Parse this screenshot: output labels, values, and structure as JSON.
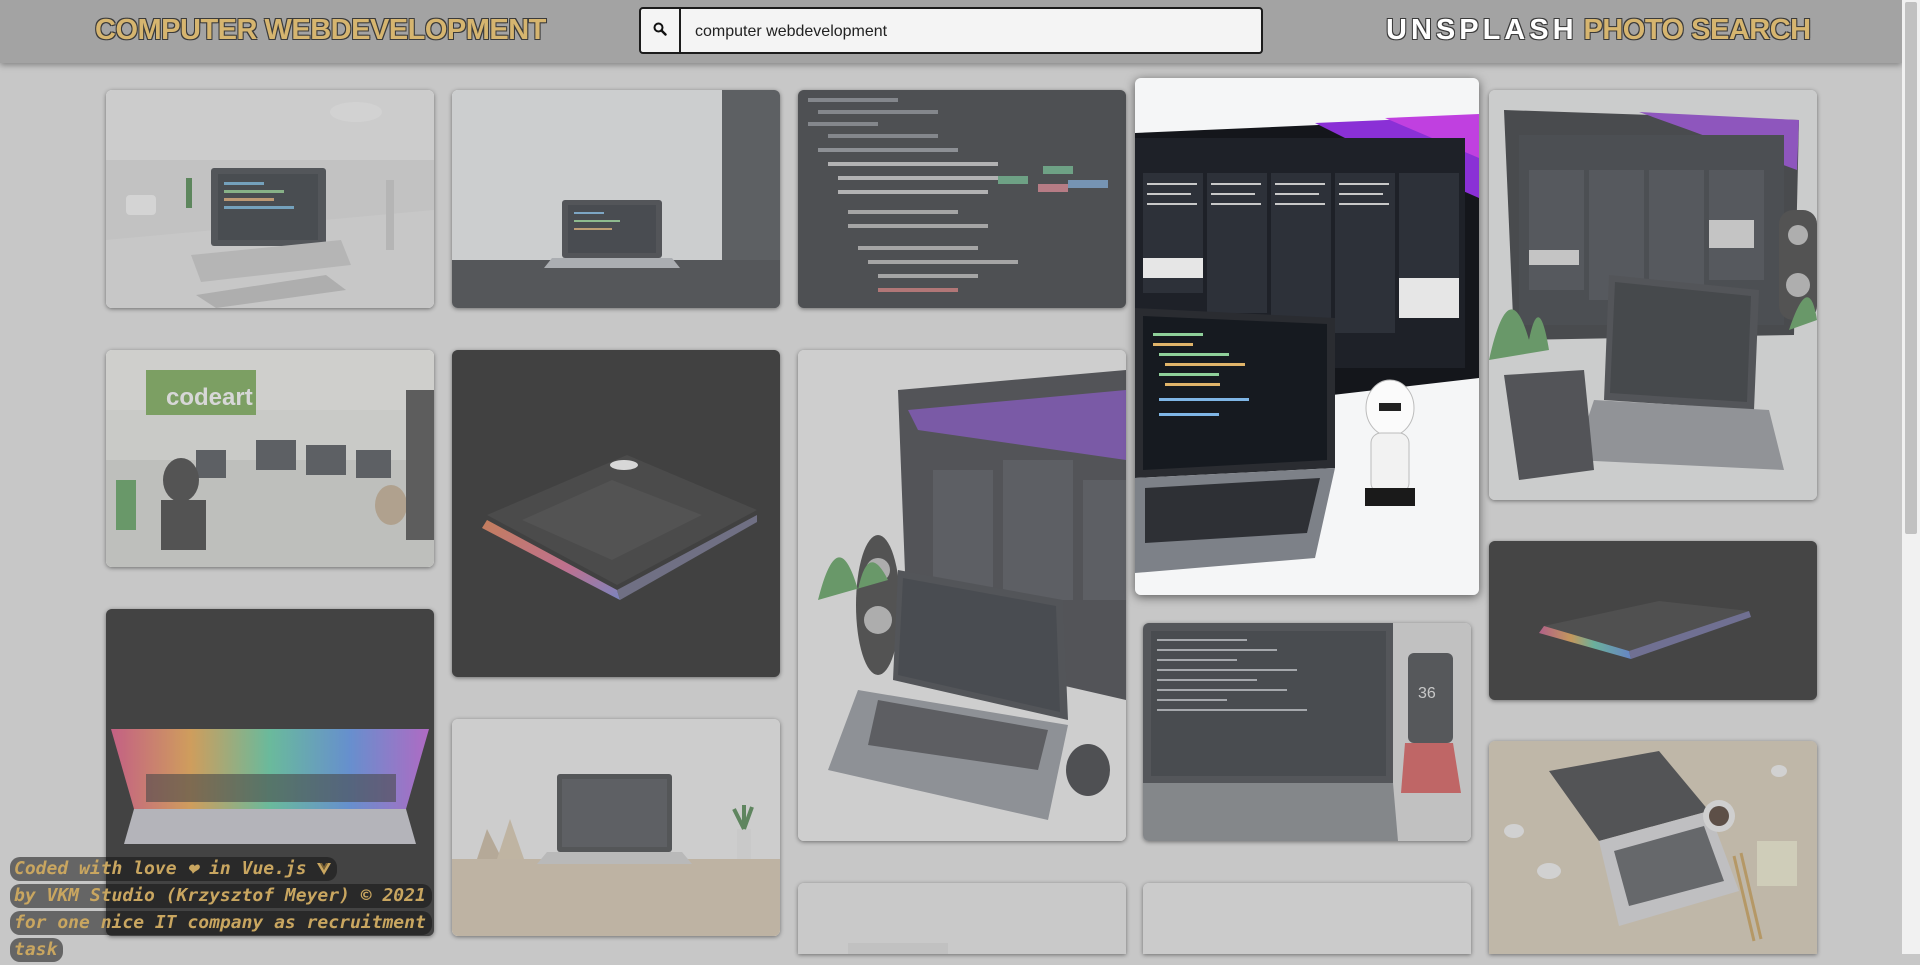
{
  "header": {
    "brand": "COMPUTER WEBDEVELOPMENT",
    "search_value": "computer webdevelopment",
    "title_word1": "UNSPLASH",
    "title_word2": "PHOTO SEARCH"
  },
  "icons": {
    "search": "search-icon",
    "heart": "heart-icon",
    "vue": "vue-logo-icon"
  },
  "colors": {
    "accent": "#d6b56f",
    "header_bg": "#a3a3a3",
    "page_bg": "#c7c7c7"
  },
  "gallery": {
    "photos": [
      {
        "subject": "laptop-on-desk"
      },
      {
        "subject": "laptop-by-window"
      },
      {
        "subject": "css-code"
      },
      {
        "subject": "desk-setup-with-stormtrooper"
      },
      {
        "subject": "monitor-and-laptop"
      },
      {
        "subject": "open-office"
      },
      {
        "subject": "laptop-in-dark"
      },
      {
        "subject": "desk-with-speaker"
      },
      {
        "subject": "laptop-colorful-dark"
      },
      {
        "subject": "laptop-rainbow-keys"
      },
      {
        "subject": "laptop-with-phone"
      },
      {
        "subject": "laptop-minimal"
      },
      {
        "subject": "laptop-coffee-flatlay"
      },
      {
        "subject": "partial-photo"
      },
      {
        "subject": "partial-photo"
      }
    ]
  },
  "footer": {
    "line1_prefix": "Coded with love",
    "line1_mid": "in Vue.js",
    "line2": "by  VKM Studio (Krzysztof Meyer)  © 2021",
    "line3": "for one nice IT company as recruitment",
    "line4": "task"
  }
}
